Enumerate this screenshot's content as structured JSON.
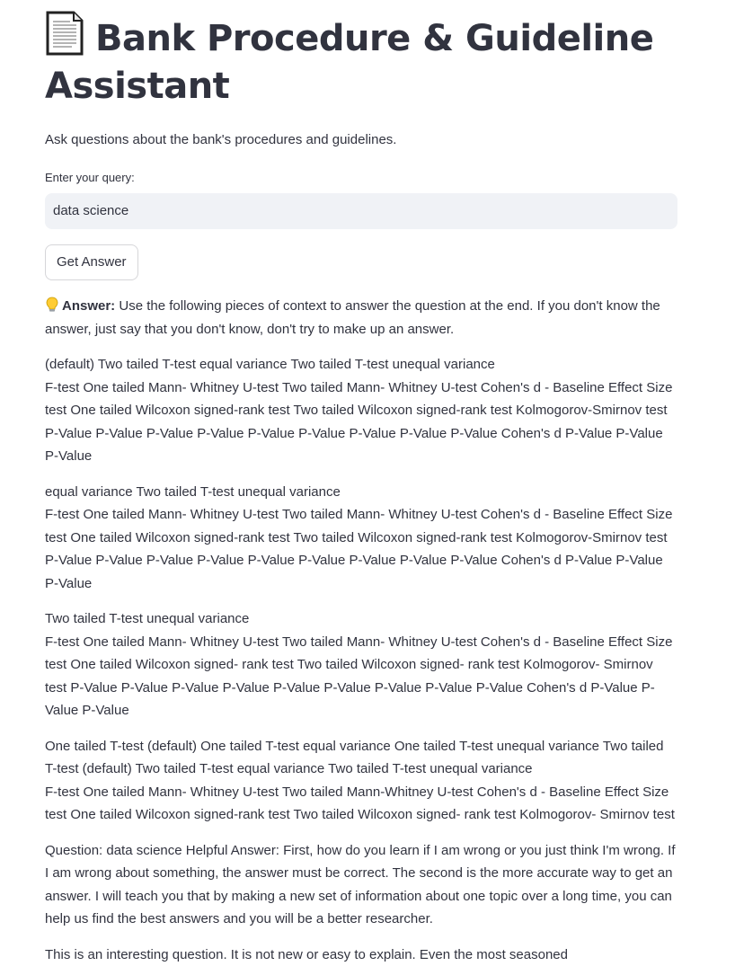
{
  "page": {
    "title": "Bank Procedure & Guideline Assistant",
    "title_icon": "document-icon",
    "subtitle": "Ask questions about the bank's procedures and guidelines."
  },
  "query": {
    "label": "Enter your query:",
    "value": "data science"
  },
  "button": {
    "label": "Get Answer"
  },
  "answer": {
    "icon": "lightbulb-icon",
    "label": "Answer:",
    "intro": "Use the following pieces of context to answer the question at the end. If you don't know the answer, just say that you don't know, don't try to make up an answer.",
    "chunks": [
      {
        "line1": "(default) Two tailed T-test equal variance Two tailed T-test unequal variance",
        "rest": "F-test One tailed Mann- Whitney U-test Two tailed Mann- Whitney U-test Cohen's d - Baseline Effect Size test One tailed Wilcoxon signed-rank test Two tailed Wilcoxon signed-rank test Kolmogorov-Smirnov test P-Value P-Value P-Value P-Value P-Value P-Value P-Value P-Value P-Value Cohen's d P-Value P-Value P-Value"
      },
      {
        "line1": "equal variance Two tailed T-test unequal variance",
        "rest": "F-test One tailed Mann- Whitney U-test Two tailed Mann- Whitney U-test Cohen's d - Baseline Effect Size test One tailed Wilcoxon signed-rank test Two tailed Wilcoxon signed-rank test Kolmogorov-Smirnov test P-Value P-Value P-Value P-Value P-Value P-Value P-Value P-Value P-Value Cohen's d P-Value P-Value P-Value"
      },
      {
        "line1": "Two tailed T-test unequal variance",
        "rest": "F-test One tailed Mann- Whitney U-test Two tailed Mann- Whitney U-test Cohen's d - Baseline Effect Size test One tailed Wilcoxon signed- rank test Two tailed Wilcoxon signed- rank test Kolmogorov- Smirnov test P-Value P-Value P-Value P-Value P-Value P-Value P-Value P-Value P-Value Cohen's d P-Value P-Value P-Value"
      },
      {
        "line1": "One tailed T-test (default) One tailed T-test equal variance One tailed T-test unequal variance Two tailed T-test (default) Two tailed T-test equal variance Two tailed T-test unequal variance",
        "rest": "F-test One tailed Mann- Whitney U-test Two tailed Mann-Whitney U-test Cohen's d - Baseline Effect Size test One tailed Wilcoxon signed-rank test Two tailed Wilcoxon signed- rank test Kolmogorov- Smirnov test"
      }
    ],
    "question": "Question: data science Helpful Answer: First, how do you learn if I am wrong or you just think I'm wrong. If I am wrong about something, the answer must be correct. The second is the more accurate way to get an answer. I will teach you that by making a new set of information about one topic over a long time, you can help us find the best answers and you will be a better researcher.",
    "closing": "This is an interesting question. It is not new or easy to explain. Even the most seasoned"
  }
}
